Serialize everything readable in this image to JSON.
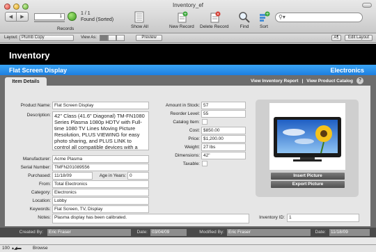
{
  "window": {
    "title": "Inventory_ef"
  },
  "toolbar": {
    "record_number": "1",
    "record_count": "1 / 1",
    "found_status": "Found (Sorted)",
    "records_label": "Records",
    "show_all": "Show All",
    "new_record": "New Record",
    "delete_record": "Delete Record",
    "find": "Find",
    "sort": "Sort"
  },
  "layoutbar": {
    "layout_label": "Layout:",
    "layout_value": "Plumb Copy",
    "view_as_label": "View As:",
    "preview": "Preview",
    "aa": "A¶",
    "edit_layout": "Edit Layout"
  },
  "header": {
    "title": "Inventory",
    "item_name": "Flat Screen Display",
    "category": "Electronics"
  },
  "tabs": {
    "item_details": "Item Details"
  },
  "links": {
    "view_inventory_report": "View Inventory Report",
    "separator": "|",
    "view_product_catalog": "View Product Catalog",
    "help": "?"
  },
  "fields": {
    "product_name": {
      "label": "Product Name:",
      "value": "Flat Screen Display"
    },
    "description": {
      "label": "Description:",
      "value": "42\" Class (41.6\" Diagonal) TM-FN1080 Series Plasma 1080p HDTV with Full-time 1080 TV Lines Moving Picture Resolution, PLUS VIEWING for easy photo sharing, and PLUS LINK to control all compatible devices with a single remote"
    },
    "manufacturer": {
      "label": "Manufacturer:",
      "value": "Acme Plasma"
    },
    "serial_number": {
      "label": "Serial Number:",
      "value": "TMFN201089556"
    },
    "purchased": {
      "label": "Purchased:",
      "value": "11/18/09"
    },
    "age_in_years": {
      "label": "Age in Years:",
      "value": "0"
    },
    "from": {
      "label": "From:",
      "value": "Total Electronics"
    },
    "category": {
      "label": "Category:",
      "value": "Electronics"
    },
    "location": {
      "label": "Location:",
      "value": "Lobby"
    },
    "keywords": {
      "label": "Keywords:",
      "value": "Flat Screen, TV, Display"
    },
    "notes": {
      "label": "Notes:",
      "value": "Plasma display has been calibrated."
    },
    "amount_in_stock": {
      "label": "Amount in Stock:",
      "value": "57"
    },
    "reorder_level": {
      "label": "Reorder Level:",
      "value": "55"
    },
    "catalog_item": {
      "label": "Catalog Item:"
    },
    "cost": {
      "label": "Cost:",
      "value": "$850.00"
    },
    "price": {
      "label": "Price:",
      "value": "$1,200.00"
    },
    "weight": {
      "label": "Weight:",
      "value": "27 lbs"
    },
    "dimensions": {
      "label": "Dimensions:",
      "value": "42\""
    },
    "taxable": {
      "label": "Taxable:"
    },
    "inventory_id": {
      "label": "Inventory ID:",
      "value": "1"
    }
  },
  "picture": {
    "insert": "Insert Picture",
    "export": "Export Picture"
  },
  "footer": {
    "created_by_label": "Created By:",
    "created_by": "Eric Fraser",
    "created_date_label": "Date:",
    "created_date": "03/04/09",
    "modified_by_label": "Modified By:",
    "modified_by": "Eric Fraser",
    "modified_date_label": "Date:",
    "modified_date": "11/18/09"
  },
  "statusbar": {
    "zoom": "100",
    "mode": "Browse"
  },
  "colors": {
    "accent_blue": "#1d7fe0",
    "header_black": "#000000",
    "panel_gray": "#e6e6e6"
  }
}
